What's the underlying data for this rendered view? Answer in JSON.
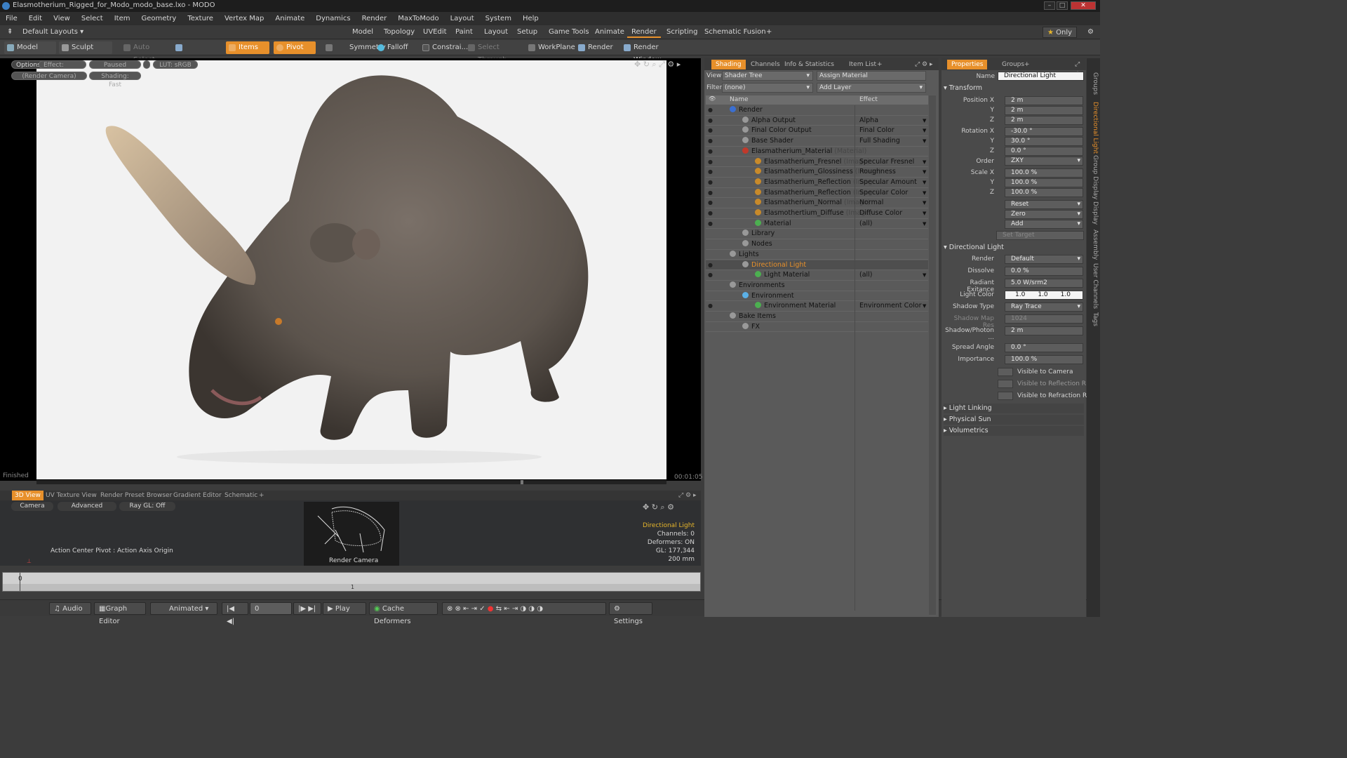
{
  "window": {
    "title": "Elasmotherium_Rigged_for_Modo_modo_base.lxo - MODO"
  },
  "menu": [
    "File",
    "Edit",
    "View",
    "Select",
    "Item",
    "Geometry",
    "Texture",
    "Vertex Map",
    "Animate",
    "Dynamics",
    "Render",
    "MaxToModo",
    "Layout",
    "System",
    "Help"
  ],
  "layoutbar": {
    "preset": "Default Layouts",
    "tabs": [
      "Model",
      "Topology",
      "UVEdit",
      "Paint",
      "Layout",
      "Setup",
      "Game Tools",
      "Animate",
      "Render",
      "Scripting",
      "Schematic Fusion"
    ],
    "active_tab": "Render",
    "only_label": "Only"
  },
  "toolbar": {
    "model": "Model",
    "sculpt": "Sculpt",
    "auto_select": "Auto Select",
    "items": "Items",
    "pivot": "Pivot",
    "symmetry": "Symmetry",
    "falloff": "Falloff",
    "constraint": "Constrai...",
    "select_through": "Select Through",
    "workplane": "WorkPlane",
    "render": "Render",
    "render_window": "Render Window"
  },
  "viewport": {
    "options": "Options",
    "effect": "Effect: (Shadi...",
    "paused": "Paused",
    "lut": "LUT: sRGB",
    "camera": "(Render Camera)",
    "shading": "Shading: Fast",
    "status": "Finished",
    "time": "00:01:05"
  },
  "lower": {
    "tabs": [
      "3D View",
      "UV Texture View",
      "Render Preset Browser",
      "Gradient Editor",
      "Schematic"
    ],
    "active_tab": "3D View",
    "camera_btn": "Camera",
    "advanced_btn": "Advanced",
    "raygl_btn": "Ray GL: Off",
    "action_center": "Action Center Pivot : Action Axis Origin",
    "thumb_label": "Render Camera",
    "info": {
      "title": "Directional Light",
      "channels": "Channels: 0",
      "deformers": "Deformers: ON",
      "gl": "GL: 177,344",
      "size": "200 mm"
    }
  },
  "timeline": {
    "start": "0",
    "mid": "1"
  },
  "transport": {
    "audio": "Audio",
    "graph_editor": "Graph Editor",
    "animated": "Animated",
    "frame": "0",
    "play": "Play",
    "cache": "Cache Deformers",
    "settings": "Settings"
  },
  "shading": {
    "tabs": [
      "Shading",
      "Channels",
      "Info & Statistics",
      "Item List"
    ],
    "active_tab": "Shading",
    "view_label": "View",
    "view_value": "Shader Tree",
    "assign": "Assign Material",
    "filter_label": "Filter",
    "filter_value": "(none)",
    "add_layer": "Add Layer",
    "col_name": "Name",
    "col_effect": "Effect",
    "rows": [
      {
        "name": "Render",
        "effect": "",
        "type": "",
        "indent": 0
      },
      {
        "name": "Alpha Output",
        "effect": "Alpha",
        "type": "",
        "indent": 1
      },
      {
        "name": "Final Color Output",
        "effect": "Final Color",
        "type": "",
        "indent": 1
      },
      {
        "name": "Base Shader",
        "effect": "Full Shading",
        "type": "",
        "indent": 1
      },
      {
        "name": "Elasmatherium_Material",
        "effect": "",
        "type": "(Material)",
        "indent": 1
      },
      {
        "name": "Elasmatherium_Fresnel",
        "effect": "Specular Fresnel",
        "type": "(Image)",
        "indent": 2
      },
      {
        "name": "Elasmatherium_Glossiness",
        "effect": "Roughness",
        "type": "(Image)",
        "indent": 2
      },
      {
        "name": "Elasmatherium_Reflection",
        "effect": "Specular Amount",
        "type": "(Image...",
        "indent": 2
      },
      {
        "name": "Elasmatherium_Reflection",
        "effect": "Specular Color",
        "type": "(Image)",
        "indent": 2
      },
      {
        "name": "Elasmatherium_Normal",
        "effect": "Normal",
        "type": "(Image)",
        "indent": 2
      },
      {
        "name": "Elasmothertium_Diffuse",
        "effect": "Diffuse Color",
        "type": "(Image)",
        "indent": 2
      },
      {
        "name": "Material",
        "effect": "(all)",
        "type": "",
        "indent": 2
      },
      {
        "name": "Library",
        "effect": "",
        "type": "",
        "indent": 1
      },
      {
        "name": "Nodes",
        "effect": "",
        "type": "",
        "indent": 1
      },
      {
        "name": "Lights",
        "effect": "",
        "type": "",
        "indent": 0
      },
      {
        "name": "Directional Light",
        "effect": "",
        "type": "",
        "indent": 1
      },
      {
        "name": "Light Material",
        "effect": "(all)",
        "type": "",
        "indent": 2
      },
      {
        "name": "Environments",
        "effect": "",
        "type": "",
        "indent": 0
      },
      {
        "name": "Environment",
        "effect": "",
        "type": "",
        "indent": 1
      },
      {
        "name": "Environment Material",
        "effect": "Environment Color",
        "type": "",
        "indent": 2
      },
      {
        "name": "Bake Items",
        "effect": "",
        "type": "",
        "indent": 0
      },
      {
        "name": "FX",
        "effect": "",
        "type": "",
        "indent": 1
      }
    ]
  },
  "properties": {
    "tabs": [
      "Properties",
      "Groups"
    ],
    "active_tab": "Properties",
    "name_label": "Name",
    "name_value": "Directional Light",
    "transform": "Transform",
    "pos_x_label": "Position X",
    "pos_x": "2 m",
    "y_label": "Y",
    "pos_y": "2 m",
    "z_label": "Z",
    "pos_z": "2 m",
    "rot_x_label": "Rotation X",
    "rot_x": "-30.0 °",
    "rot_y": "30.0 °",
    "rot_z": "0.0 °",
    "order_label": "Order",
    "order": "ZXY",
    "scale_x_label": "Scale X",
    "scale_x": "100.0 %",
    "scale_y": "100.0 %",
    "scale_z": "100.0 %",
    "reset": "Reset",
    "zero": "Zero",
    "add": "Add",
    "set_target": "Set Target",
    "section_light": "Directional Light",
    "render_label": "Render",
    "render_value": "Default",
    "dissolve_label": "Dissolve",
    "dissolve": "0.0 %",
    "radiant_label": "Radiant Exitance",
    "radiant": "5.0 W/srm2",
    "color_label": "Light Color",
    "color": [
      "1.0",
      "1.0",
      "1.0"
    ],
    "shadow_label": "Shadow Type",
    "shadow": "Ray Trace",
    "shadowres_label": "Shadow Map Res",
    "shadowres": "1024",
    "photon_label": "Shadow/Photon ...",
    "photon": "2 m",
    "spread_label": "Spread Angle",
    "spread": "0.0 °",
    "importance_label": "Importance",
    "importance": "100.0 %",
    "vis_camera": "Visible to Camera",
    "vis_reflection": "Visible to Reflection R ...",
    "vis_refraction": "Visible to Refraction R...",
    "light_linking": "Light Linking",
    "physical_sun": "Physical Sun",
    "volumetrics": "Volumetrics"
  },
  "sidetabs": [
    "Groups",
    "Directional Light",
    "Group Display",
    "Display",
    "Assembly",
    "User Channels",
    "Tags"
  ],
  "colors": {
    "accent": "#e7902b",
    "panel": "#5a5a5a",
    "dark": "#2e2e2e"
  }
}
